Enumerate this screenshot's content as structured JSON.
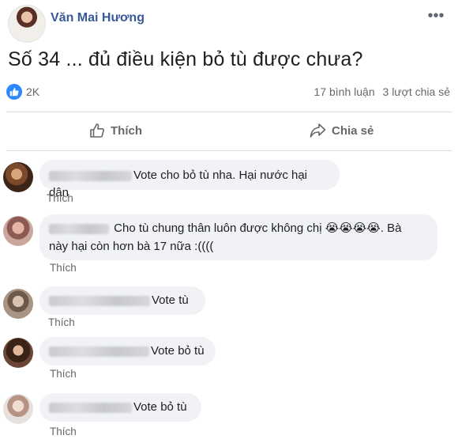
{
  "post": {
    "author": "Văn Mai Hương",
    "more_icon": "•••",
    "text": "Số 34 ... đủ điều kiện bỏ tù được chưa?",
    "reaction_icon": "like-icon",
    "reaction_count": "2K",
    "comment_count": "17 bình luận",
    "share_count": "3 lượt chia sẻ"
  },
  "actions": {
    "like_label": "Thích",
    "share_label": "Chia sẻ"
  },
  "comments": [
    {
      "text": "Vote cho bỏ tù nha. Hại nước hại dân",
      "like_label": "Thích"
    },
    {
      "text_line1": "Cho tù chung thân luôn được không chị 😭😭😭😭. Bà",
      "text_line2": "này hại còn hơn bà 17 nữa :((((",
      "like_label": "Thích"
    },
    {
      "text": "Vote tù",
      "like_label": "Thích"
    },
    {
      "text": "Vote bỏ tù",
      "like_label": "Thích"
    },
    {
      "text": "Vote bỏ tù",
      "like_label": "Thích"
    }
  ],
  "colors": {
    "author_name": "#385898",
    "secondary_text": "#65676b",
    "bubble_bg": "#f0f2f5",
    "like_badge": "#2d88ff"
  }
}
